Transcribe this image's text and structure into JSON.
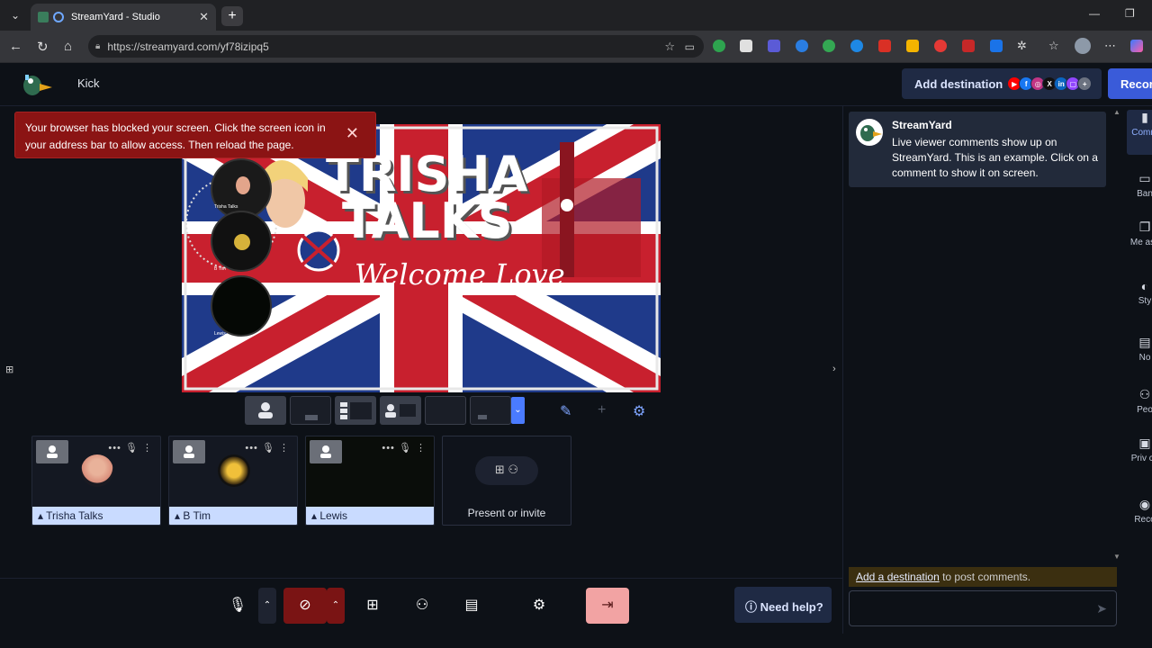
{
  "browser": {
    "tab_title": "StreamYard - Studio",
    "url": "https://streamyard.com/yf78izipq5"
  },
  "header": {
    "destination_label": "Kick",
    "add_destination": "Add destination",
    "record": "Record"
  },
  "alert": {
    "message": "Your browser has blocked your screen. Click the screen icon in your address bar to allow access. Then reload the page."
  },
  "stage": {
    "banner_line1": "TRISHA",
    "banner_line2": "TALKS",
    "banner_script": "Welcome Love",
    "bubbles": [
      "Trisha Talks",
      "B Tim",
      "Lewis"
    ]
  },
  "participants": [
    {
      "name": "Trisha Talks"
    },
    {
      "name": "B Tim"
    },
    {
      "name": "Lewis"
    }
  ],
  "invite": {
    "label": "Present or invite"
  },
  "toolbar": {
    "need_help": "Need help?"
  },
  "comments": {
    "author": "StreamYard",
    "message": "Live viewer comments show up on StreamYard. This is an example. Click on a comment to show it on screen.",
    "note_link": "Add a destination",
    "note_rest": " to post comments."
  },
  "sidebar": {
    "items": [
      "Comm",
      "Ban",
      "Me ass",
      "Sty",
      "No",
      "Peo",
      "Priv ch",
      "Reco"
    ]
  },
  "colors": {
    "accent": "#3a5bd9",
    "alert": "#8b1414",
    "name_tag": "#c9dbff",
    "leave": "#f2a3a3"
  }
}
